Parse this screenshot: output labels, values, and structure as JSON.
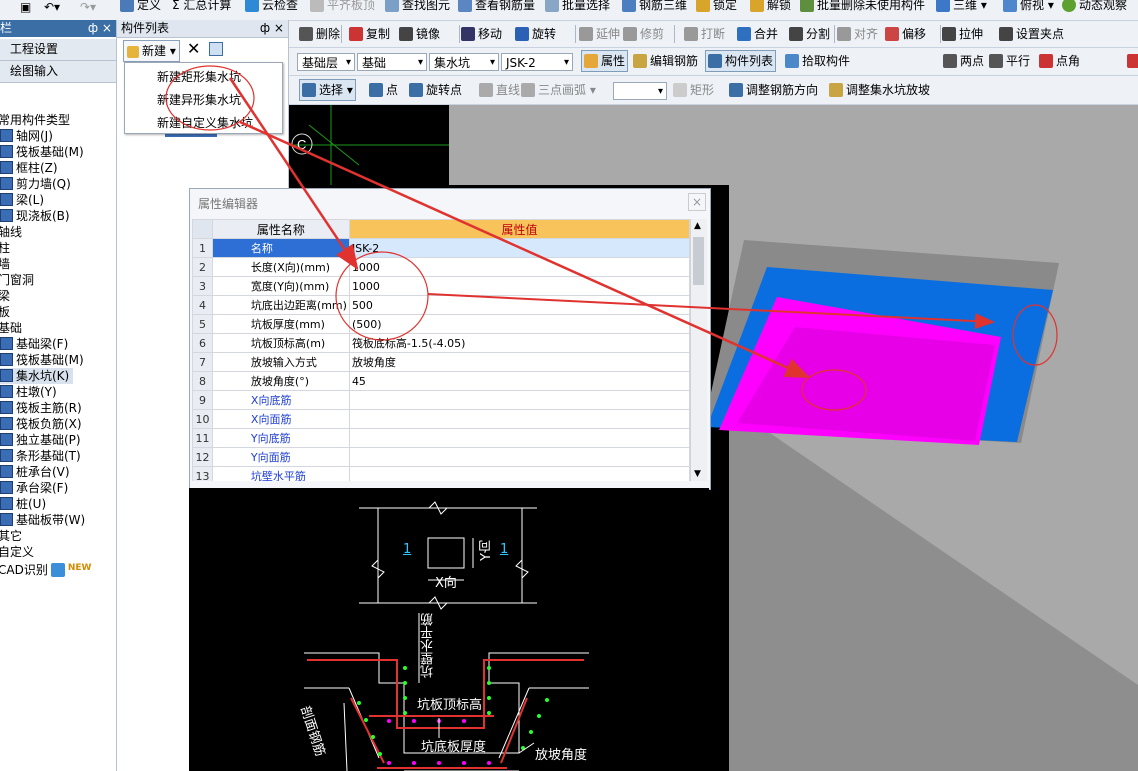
{
  "topbar": {
    "items": [
      "定义",
      "汇总计算",
      "云检查",
      "平齐板顶",
      "查找图元",
      "查看钢筋量",
      "批量选择",
      "钢筋三维",
      "锁定",
      "解锁",
      "批量删除未使用构件",
      "三维",
      "俯视",
      "动态观察"
    ]
  },
  "left_panel": {
    "header": "导航栏",
    "pin": "ф ×",
    "tabs": [
      "工程设置",
      "绘图输入"
    ],
    "tree": [
      "常用构件类型",
      "轴网(J)",
      "筏板基础(M)",
      "框柱(Z)",
      "剪力墙(Q)",
      "梁(L)",
      "现浇板(B)",
      "轴线",
      "柱",
      "墙",
      "门窗洞",
      "梁",
      "板",
      "基础",
      "基础梁(F)",
      "筏板基础(M)",
      "集水坑(K)",
      "柱墩(Y)",
      "筏板主筋(R)",
      "筏板负筋(X)",
      "独立基础(P)",
      "条形基础(T)",
      "桩承台(V)",
      "承台梁(F)",
      "桩(U)",
      "基础板带(W)",
      "其它",
      "自定义",
      "CAD识别"
    ],
    "new_badge": "NEW"
  },
  "component_list": {
    "title": "构件列表",
    "pin": "ф ×",
    "new_button": "新建",
    "menu": [
      "新建矩形集水坑",
      "新建异形集水坑",
      "新建自定义集水坑"
    ]
  },
  "toolbar2": {
    "items": [
      "删除",
      "复制",
      "镜像",
      "移动",
      "旋转",
      "延伸",
      "修剪",
      "打断",
      "合并",
      "分割",
      "对齐",
      "偏移",
      "拉伸",
      "设置夹点"
    ]
  },
  "toolbar3": {
    "layer": "基础层",
    "type": "基础",
    "component": "集水坑",
    "name": "JSK-2",
    "items": [
      "属性",
      "编辑钢筋",
      "构件列表",
      "拾取构件",
      "两点",
      "平行",
      "点角",
      "三"
    ]
  },
  "toolbar4": {
    "items": [
      "选择",
      "点",
      "旋转点",
      "直线",
      "三点画弧",
      "矩形",
      "调整钢筋方向",
      "调整集水坑放坡"
    ]
  },
  "property_editor": {
    "title": "属性编辑器",
    "close": "×",
    "col_name": "属性名称",
    "col_value": "属性值",
    "rows": [
      {
        "n": "1",
        "name": "名称",
        "value": "JSK-2",
        "blue": false
      },
      {
        "n": "2",
        "name": "长度(X向)(mm)",
        "value": "1000",
        "blue": false
      },
      {
        "n": "3",
        "name": "宽度(Y向)(mm)",
        "value": "1000",
        "blue": false
      },
      {
        "n": "4",
        "name": "坑底出边距离(mm)",
        "value": "500",
        "blue": false
      },
      {
        "n": "5",
        "name": "坑板厚度(mm)",
        "value": "(500)",
        "blue": false
      },
      {
        "n": "6",
        "name": "坑板顶标高(m)",
        "value": "筏板底标高-1.5(-4.05)",
        "blue": false
      },
      {
        "n": "7",
        "name": "放坡输入方式",
        "value": "放坡角度",
        "blue": false
      },
      {
        "n": "8",
        "name": "放坡角度(°)",
        "value": "45",
        "blue": false
      },
      {
        "n": "9",
        "name": "X向底筋",
        "value": "",
        "blue": true
      },
      {
        "n": "10",
        "name": "X向面筋",
        "value": "",
        "blue": true
      },
      {
        "n": "11",
        "name": "Y向底筋",
        "value": "",
        "blue": true
      },
      {
        "n": "12",
        "name": "Y向面筋",
        "value": "",
        "blue": true
      },
      {
        "n": "13",
        "name": "坑壁水平筋",
        "value": "",
        "blue": true
      }
    ]
  },
  "cad_drawing": {
    "label_1a": "1",
    "label_1b": "1",
    "xdir": "X向",
    "ydir": "Y向",
    "wall_rebar": "坑壁水平筋",
    "top_elev": "坑板顶标高",
    "thickness": "坑底板厚度",
    "slope_angle": "放坡角度",
    "section": "剖面钢筋"
  },
  "viewport": {
    "axis_label": "C",
    "colors": {
      "blue": "#0a6ee0",
      "magenta": "#ff00ff",
      "gray": "#a9a9a9",
      "black": "#000000",
      "red": "#e0322f"
    }
  }
}
